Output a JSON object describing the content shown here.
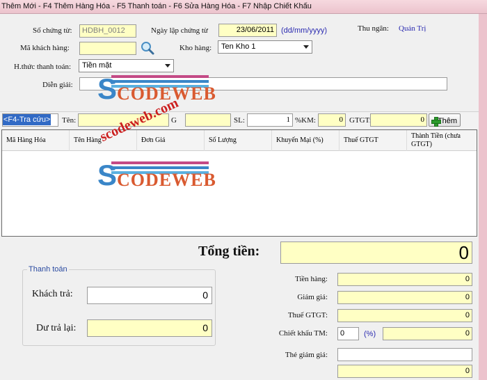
{
  "title": "Thêm Mới - F4 Thêm Hàng Hóa - F5 Thanh toán - F6 Sửa Hàng Hóa - F7 Nhập Chiết Khấu",
  "header": {
    "so_chung_tu_label": "Số chứng từ:",
    "so_chung_tu_value": "HDBH_0012",
    "ngay_lap_label": "Ngày lập chứng từ",
    "ngay_lap_value": "23/06/2011",
    "date_format_hint": "(dd/mm/yyyy)",
    "thu_ngan_label": "Thu ngân:",
    "thu_ngan_value": "Quản Trị",
    "ma_khach_hang_label": "Mã khách hàng:",
    "ma_khach_hang_value": "",
    "kho_hang_label": "Kho hàng:",
    "kho_hang_value": "Ten Kho 1",
    "hthuc_label": "H.thức thanh toán:",
    "hthuc_value": "Tiền mặt",
    "dien_giai_label": "Diễn giải:",
    "dien_giai_value": ""
  },
  "entry": {
    "lookup_value": "<F4-Tra cứu>",
    "ten_label": "Tên:",
    "ten_value": "",
    "gia_label": "G",
    "gia_value": "",
    "sl_label": "SL:",
    "sl_value": "1",
    "km_label": "%KM:",
    "km_value": "0",
    "gtgt_label": "GTGT:",
    "gtgt_value": "0",
    "add_button": "Thêm"
  },
  "grid": {
    "columns": [
      "Mã Hàng Hóa",
      "Tên Hàng",
      "Đơn Giá",
      "Số Lượng",
      "Khuyến Mại (%)",
      "Thuế GTGT",
      "Thành Tiền (chưa GTGT)"
    ],
    "rows": []
  },
  "totals": {
    "tong_tien_label": "Tổng tiền:",
    "tong_tien_value": "0",
    "tien_hang_label": "Tiền hàng:",
    "tien_hang_value": "0",
    "giam_gia_label": "Giảm giá:",
    "giam_gia_value": "0",
    "thue_label": "Thuế GTGT:",
    "thue_value": "0",
    "chiet_khau_label": "Chiết khấu TM:",
    "chiet_khau_pct": "0",
    "chiet_khau_unit": "(%)",
    "chiet_khau_value": "0",
    "the_giam_gia_label": "Thẻ giảm giá:",
    "the_giam_gia_value": "",
    "the_giam_gia_amount": "0"
  },
  "payment": {
    "group_title": "Thanh toán",
    "khach_tra_label": "Khách trả:",
    "khach_tra_value": "0",
    "du_tra_lai_label": "Dư trả lại:",
    "du_tra_lai_value": "0"
  },
  "watermark": {
    "logo_s": "S",
    "logo_rest": "CODEWEB",
    "site": "scodeweb.com"
  },
  "colors": {
    "field_yellow": "#ffffc4",
    "titlebar_pink": "#ecc3cd",
    "label_blue": "#2a2ab0",
    "logo_blue": "#3a86c8",
    "logo_orange": "#d95a30",
    "watermark_red": "#cc1f1f"
  },
  "icons": {
    "lookup": "magnifier-icon",
    "dropdown": "chevron-down-icon",
    "add": "plus-icon"
  }
}
